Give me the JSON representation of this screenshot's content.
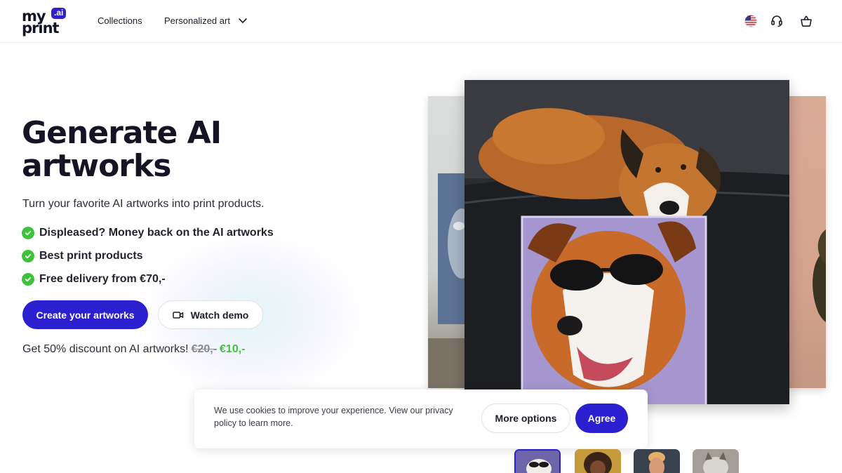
{
  "header": {
    "logo": {
      "word1": "my",
      "word2": "print",
      "badge": ".ai"
    },
    "nav": {
      "collections": "Collections",
      "personalized": "Personalized art"
    },
    "icons": [
      "us-flag-icon",
      "headset-icon",
      "basket-icon"
    ]
  },
  "hero": {
    "title": "Generate AI artworks",
    "subtitle": "Turn your favorite AI artworks into print products.",
    "bullets": [
      "Displeased? Money back on the AI artworks",
      "Best print products",
      "Free delivery from €70,-"
    ],
    "cta_primary": "Create your artworks",
    "cta_secondary": "Watch demo",
    "discount": {
      "text": "Get 50% discount on AI artworks!",
      "old_price": "€20,-",
      "new_price": "€10,-"
    }
  },
  "cookie": {
    "text": "We use cookies to improve your experience. View our privacy policy to learn more.",
    "more_options": "More options",
    "agree": "Agree"
  },
  "colors": {
    "accent": "#2b1fd0",
    "check": "#3fc23b",
    "text": "#1d1d2b"
  }
}
